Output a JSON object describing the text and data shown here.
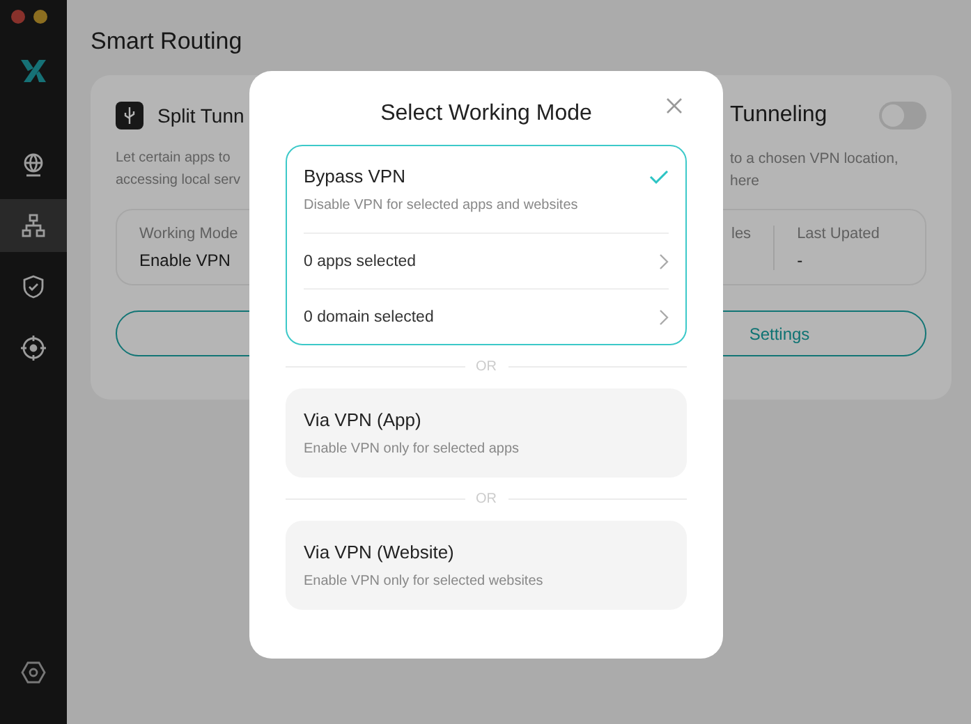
{
  "sidebar": {
    "items": [
      {
        "kind": "globe",
        "selected": false
      },
      {
        "kind": "network",
        "selected": true
      },
      {
        "kind": "shield",
        "selected": false
      },
      {
        "kind": "target",
        "selected": false
      }
    ]
  },
  "page": {
    "title": "Smart Routing"
  },
  "cards": [
    {
      "title": "Split Tunn",
      "description": [
        "Let certain apps to",
        "accessing local serv"
      ],
      "stats": [
        {
          "label": "Working Mode",
          "value": "Enable VPN"
        }
      ]
    },
    {
      "title": "Tunneling",
      "toggle_on": false,
      "description": [
        "to a chosen VPN location,",
        "here"
      ],
      "stats": [
        {
          "label": "les"
        },
        {
          "label": "Last Upated",
          "value": "-"
        }
      ],
      "button": "Settings"
    }
  ],
  "dialog": {
    "title": "Select Working Mode",
    "modes": [
      {
        "title": "Bypass VPN",
        "description": "Disable VPN for selected apps and websites",
        "selected": true,
        "rows": [
          "0 apps selected",
          "0 domain selected"
        ]
      },
      {
        "title": "Via VPN (App)",
        "description": "Enable VPN only for selected apps",
        "selected": false
      },
      {
        "title": "Via VPN (Website)",
        "description": "Enable VPN only for selected websites",
        "selected": false
      }
    ],
    "separators": [
      "OR",
      "OR"
    ]
  }
}
